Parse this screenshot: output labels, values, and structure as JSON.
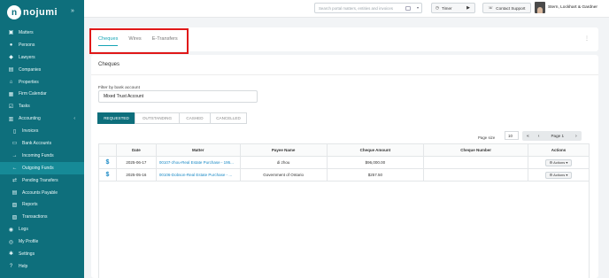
{
  "app": {
    "logo_text": "nojumi"
  },
  "sidebar": {
    "items": [
      {
        "label": "Matters",
        "icon": "briefcase-icon",
        "glyph": "▣"
      },
      {
        "label": "Persons",
        "icon": "people-icon",
        "glyph": "●"
      },
      {
        "label": "Lawyers",
        "icon": "lawyer-icon",
        "glyph": "◆"
      },
      {
        "label": "Companies",
        "icon": "building-icon",
        "glyph": "▤"
      },
      {
        "label": "Properties",
        "icon": "home-icon",
        "glyph": "⌂"
      },
      {
        "label": "Firm Calendar",
        "icon": "calendar-icon",
        "glyph": "▦"
      },
      {
        "label": "Tasks",
        "icon": "checklist-icon",
        "glyph": "☑"
      },
      {
        "label": "Accounting",
        "icon": "accounting-icon",
        "glyph": "▥",
        "chevron": "‹"
      },
      {
        "label": "Invoices",
        "icon": "invoice-icon",
        "glyph": "▯",
        "sub": true
      },
      {
        "label": "Bank Accounts",
        "icon": "bank-icon",
        "glyph": "▭",
        "sub": true
      },
      {
        "label": "Incoming Funds",
        "icon": "arrow-in-icon",
        "glyph": "→",
        "sub": true
      },
      {
        "label": "Outgoing Funds",
        "icon": "arrow-out-icon",
        "glyph": "←",
        "sub": true,
        "active": true
      },
      {
        "label": "Pending Transfers",
        "icon": "transfer-icon",
        "glyph": "⇄",
        "sub": true
      },
      {
        "label": "Accounts Payable",
        "icon": "payable-icon",
        "glyph": "▤",
        "sub": true
      },
      {
        "label": "Reports",
        "icon": "report-icon",
        "glyph": "▧",
        "sub": true
      },
      {
        "label": "Transactions",
        "icon": "transactions-icon",
        "glyph": "▨",
        "sub": true
      },
      {
        "label": "Logs",
        "icon": "logs-icon",
        "glyph": "◉"
      },
      {
        "label": "My Profile",
        "icon": "profile-icon",
        "glyph": "◎"
      },
      {
        "label": "Settings",
        "icon": "gear-icon",
        "glyph": "✱"
      },
      {
        "label": "Help",
        "icon": "help-icon",
        "glyph": "?"
      }
    ]
  },
  "topbar": {
    "search_placeholder": "Search portal matters, entities and invoices",
    "timer_label": "Timer",
    "support_label": "Contact Support",
    "user_name": "Stern, Lockhart & Gardner"
  },
  "tabs": [
    {
      "label": "Cheques",
      "active": true
    },
    {
      "label": "Wires",
      "active": false
    },
    {
      "label": "E-Transfers",
      "active": false
    }
  ],
  "main": {
    "title": "Cheques",
    "filter_label": "Filter by bank account",
    "bank_account": "Mixed Trust Account",
    "status_tabs": [
      {
        "label": "REQUESTED",
        "active": true
      },
      {
        "label": "OUTSTANDING",
        "active": false
      },
      {
        "label": "CASHED",
        "active": false
      },
      {
        "label": "CANCELLED",
        "active": false
      }
    ],
    "page_size_label": "Page size",
    "page_size": "10",
    "pager": {
      "first": "«",
      "prev": "‹",
      "page": "Page 1",
      "next": "›"
    }
  },
  "table": {
    "headers": [
      "",
      "Date",
      "Matter",
      "Payee Name",
      "Cheque Amount",
      "Cheque Number",
      "Actions"
    ],
    "rows": [
      {
        "icon": "$",
        "date": "2025-06-17",
        "matter": "00107-zhou-Real Estate Purchase - 195...",
        "payee": "di zhou",
        "amount": "$96,000.00",
        "number": "",
        "action": "⚙ Actions ▾"
      },
      {
        "icon": "$",
        "date": "2025-05-16",
        "matter": "00106-Dobson-Real Estate Purchase - ...",
        "payee": "Government of Ontario",
        "amount": "$257.50",
        "number": "",
        "action": "⚙ Actions ▾"
      }
    ]
  }
}
